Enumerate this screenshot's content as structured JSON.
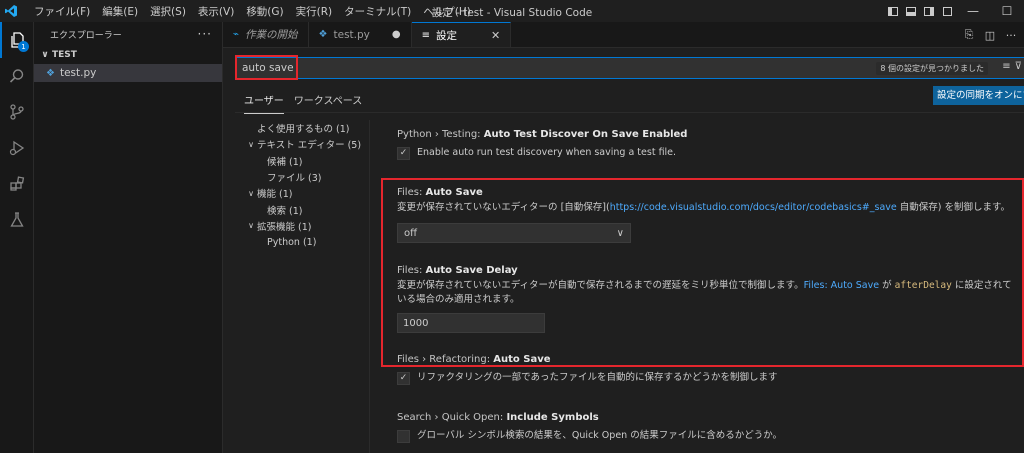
{
  "titlebar": {
    "menu": [
      "ファイル(F)",
      "編集(E)",
      "選択(S)",
      "表示(V)",
      "移動(G)",
      "実行(R)",
      "ターミナル(T)",
      "ヘルプ(H)"
    ],
    "title": "設定 - test - Visual Studio Code",
    "window_controls": {
      "minimize": "—",
      "maximize": "☐"
    }
  },
  "activitybar": {
    "explorer_badge": "1"
  },
  "sidebar": {
    "header": "エクスプローラー",
    "more": "···",
    "folder": "TEST",
    "file": "test.py"
  },
  "tabs": [
    {
      "label": "作業の開始",
      "italic": true
    },
    {
      "label": "test.py",
      "dirty": "●"
    },
    {
      "label": "設定",
      "close": "✕"
    }
  ],
  "search": {
    "value": "auto save",
    "result_count": "8 個の設定が見つかりました"
  },
  "scope_tabs": [
    "ユーザー",
    "ワークスペース"
  ],
  "sync_button": "設定の同期をオンにする",
  "toc": [
    {
      "label": "よく使用するもの (1)",
      "indent": 0,
      "chevron": ""
    },
    {
      "label": "テキスト エディター (5)",
      "indent": 0,
      "chevron": "∨"
    },
    {
      "label": "候補 (1)",
      "indent": 1,
      "chevron": ""
    },
    {
      "label": "ファイル (3)",
      "indent": 1,
      "chevron": ""
    },
    {
      "label": "機能 (1)",
      "indent": 0,
      "chevron": "∨"
    },
    {
      "label": "検索 (1)",
      "indent": 1,
      "chevron": ""
    },
    {
      "label": "拡張機能 (1)",
      "indent": 0,
      "chevron": "∨"
    },
    {
      "label": "Python (1)",
      "indent": 1,
      "chevron": ""
    }
  ],
  "settings": {
    "python_testing": {
      "category": "Python › Testing: ",
      "name": "Auto Test Discover On Save Enabled",
      "desc": "Enable auto run test discovery when saving a test file.",
      "checked": true
    },
    "files_auto_save": {
      "category": "Files: ",
      "name": "Auto Save",
      "desc_before": "変更が保存されていないエディターの [自動保存](",
      "desc_link": "https://code.visualstudio.com/docs/editor/codebasics#_save",
      "desc_after": " 自動保存) を制御します。",
      "value": "off"
    },
    "files_auto_save_delay": {
      "category": "Files: ",
      "name": "Auto Save Delay",
      "desc_before": "変更が保存されていないエディターが自動で保存されるまでの遅延をミリ秒単位で制御します。",
      "desc_link": "Files: Auto Save",
      "desc_mid": " が ",
      "desc_code": "afterDelay",
      "desc_after": " に設定されている場合のみ適用されます。",
      "value": "1000"
    },
    "files_refactoring": {
      "category": "Files › Refactoring: ",
      "name": "Auto Save",
      "desc": "リファクタリングの一部であったファイルを自動的に保存するかどうかを制御します",
      "checked": true
    },
    "search_quick_open": {
      "category": "Search › Quick Open: ",
      "name": "Include Symbols",
      "desc": "グローバル シンボル検索の結果を、Quick Open の結果ファイルに含めるかどうか。",
      "checked": false
    }
  },
  "colors": {
    "accent": "#0078d4",
    "highlight_box": "#e5262d",
    "link": "#4daafc"
  }
}
